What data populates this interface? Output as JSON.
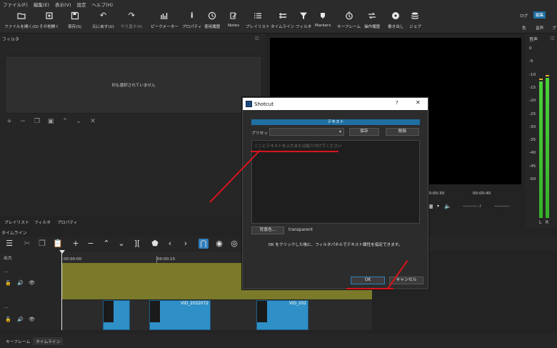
{
  "menu": [
    "ファイル(F)",
    "編集(E)",
    "表示(V)",
    "設定",
    "ヘルプ(H)"
  ],
  "toolbar": [
    {
      "label": "ファイルを開く(O)",
      "icon": "folder-icon"
    },
    {
      "label": "その他開く",
      "icon": "open-other-icon"
    },
    {
      "label": "保存(S)",
      "icon": "save-icon"
    },
    {
      "label": "元に戻す(U)",
      "icon": "undo-icon"
    },
    {
      "label": "やり直す(R)",
      "icon": "redo-icon"
    },
    {
      "label": "ピークメーター",
      "icon": "peak-meter-icon"
    },
    {
      "label": "プロパティ",
      "icon": "info-icon"
    },
    {
      "label": "使用履歴",
      "icon": "history-icon"
    },
    {
      "label": "Notes",
      "icon": "notes-icon"
    },
    {
      "label": "プレイリスト",
      "icon": "playlist-icon"
    },
    {
      "label": "タイムライン",
      "icon": "timeline-icon"
    },
    {
      "label": "フィルタ",
      "icon": "filter-icon"
    },
    {
      "label": "Markers",
      "icon": "marker-icon"
    },
    {
      "label": "キーフレーム",
      "icon": "keyframe-icon"
    },
    {
      "label": "操作履歴",
      "icon": "jobs-history-icon"
    },
    {
      "label": "書き出し",
      "icon": "export-icon"
    },
    {
      "label": "ジョブ",
      "icon": "jobs-icon"
    }
  ],
  "workspace": {
    "log": "ログ",
    "edit": "編集",
    "color": "色",
    "audio": "音声",
    "more": "プ"
  },
  "filter_panel": {
    "title": "フィルタ",
    "empty_message": "何も選択されていません"
  },
  "left_tabs": [
    "プレイリスト",
    "フィルタ",
    "プロパティ"
  ],
  "meter": {
    "title": "音声",
    "ticks": [
      "0",
      "-5",
      "-10",
      "-15",
      "-20",
      "-25",
      "-30",
      "-35",
      "-40",
      "-45",
      "-50"
    ],
    "left": "L",
    "right": "R",
    "level_left": 0.78,
    "level_right": 0.8
  },
  "player": {
    "t1": "00:00:30",
    "t2": "00:00:40",
    "timecode_a": "--:--:--:-- /",
    "timecode_b": "--:--:--:--"
  },
  "timeline": {
    "title": "タイムライン",
    "output_label": "出力",
    "ticks": [
      "00:00:00",
      "00:00:15"
    ],
    "track_dots": "...",
    "clips": [
      {
        "name": ""
      },
      {
        "name": ""
      },
      {
        "name": "VID_2022072"
      },
      {
        "name": ""
      },
      {
        "name": "VID_202"
      }
    ]
  },
  "bottom_tabs": [
    "キーフレーム",
    "タイムライン"
  ],
  "dialog": {
    "title": "Shotcut",
    "help": "?",
    "close": "✕",
    "filter_name": "テキスト",
    "preset_label": "プリセット",
    "save_label": "保存",
    "delete_label": "削除",
    "text_placeholder": "ここにテキストを入力または貼り付けてください",
    "bg_button": "背景色...",
    "bg_value": "transparent",
    "hint": "OK をクリックした後に、フィルタパネルでテキスト属性を指定できます。",
    "ok_label": "OK",
    "cancel_label": "キャンセル"
  }
}
